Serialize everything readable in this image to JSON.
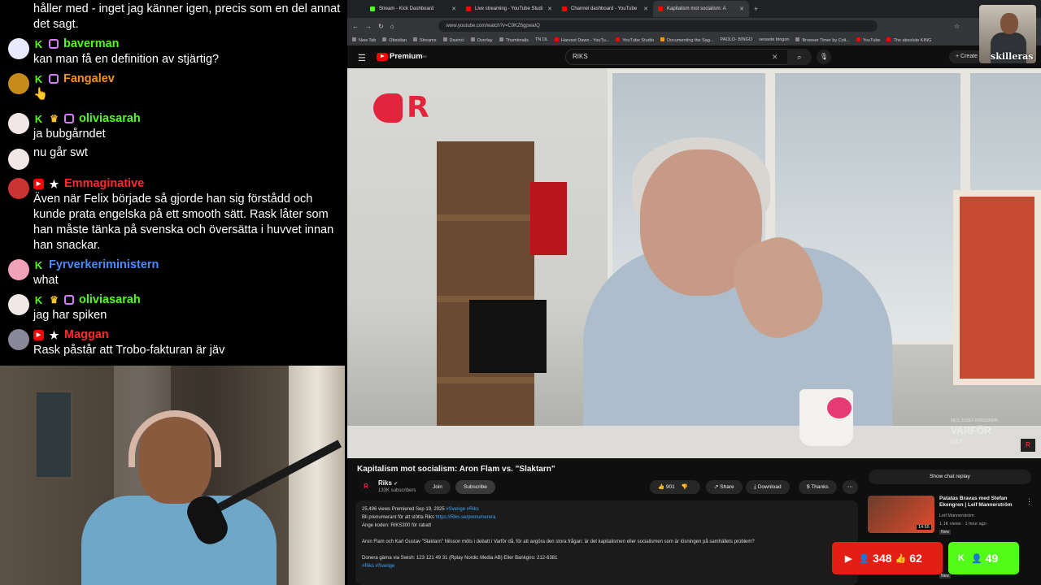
{
  "chat": {
    "messages": [
      {
        "user": "",
        "color": "#ffffff",
        "text": "håller med - inget jag känner igen, precis som en del annat det sagt.",
        "badges": []
      },
      {
        "user": "baverman",
        "color": "#53fc18",
        "text": "kan man få en definition av stjärtig?",
        "badges": [
          "kick",
          "sub"
        ]
      },
      {
        "user": "Fangalev",
        "color": "#f7941d",
        "text": "👆",
        "badges": [
          "kick",
          "sub"
        ]
      },
      {
        "user": "oliviasarah",
        "color": "#53fc18",
        "text": "ja bubgårndet",
        "badges": [
          "kick",
          "crown",
          "sub"
        ]
      },
      {
        "user": "",
        "color": "#ffffff",
        "text": "nu går swt",
        "badges": []
      },
      {
        "user": "Emmaginative",
        "color": "#ff2b2b",
        "text": "Även när Felix började så gjorde han sig förstådd och kunde prata engelska på ett smooth sätt. Rask låter som han måste tänka på svenska och översätta i huvvet innan han snackar.",
        "badges": [
          "youtube",
          "star"
        ]
      },
      {
        "user": "Fyrverkeriministern",
        "color": "#4a8cff",
        "text": "what",
        "badges": [
          "kick"
        ]
      },
      {
        "user": "oliviasarah",
        "color": "#53fc18",
        "text": "jag har spiken",
        "badges": [
          "kick",
          "crown",
          "sub"
        ]
      },
      {
        "user": "Maggan",
        "color": "#ff2b2b",
        "text": "Rask påstår att Trobo-fakturan är jäv",
        "badges": [
          "youtube",
          "star"
        ]
      }
    ]
  },
  "browser": {
    "tabs": [
      {
        "label": "Stream - Kick Dashboard",
        "icon": "kick"
      },
      {
        "label": "Live streaming - YouTube Studi",
        "icon": "youtube"
      },
      {
        "label": "Channel dashboard - YouTube",
        "icon": "youtube"
      },
      {
        "label": "Kapitalism mot socialism: A",
        "icon": "youtube",
        "active": true
      }
    ],
    "url": "www.youtube.com/watch?v=C9KZ6gpwaIQ",
    "bookmarks": [
      "New Tab",
      "Obsidian",
      "Streams",
      "Davinci",
      "Overlay",
      "Thumbnails",
      "TN DL",
      "Harvest Dawn - YouTu...",
      "YouTube Studio",
      "Documenting the Sag...",
      "PAOLO- BINGO",
      "senaste bingon",
      "Browser Timer by Coli...",
      "YouTube",
      "The absolute KING"
    ]
  },
  "youtube": {
    "logo_text": "Premium",
    "logo_sup": "SE",
    "search_value": "RIKS",
    "create_label": "Create",
    "video": {
      "title": "Kapitalism mot socialism: Aron Flam vs. \"Slaktarn\"",
      "channel": "Riks",
      "subscribers": "133K subscribers",
      "join_label": "Join",
      "subscribe_label": "Subscribe",
      "likes": "901",
      "share_label": "Share",
      "download_label": "Download",
      "thanks_label": "Thanks",
      "watermark_line1": "VARFÖR",
      "watermark_line2": "DÅ?",
      "watermark_small": "MED JOSEF KRESSNER",
      "description": {
        "meta": "25,496 views  Premiered Sep 19, 2025",
        "tags": "#Sverige #Riks",
        "line1": "Bli prenumerant för att stötta Riks",
        "line1_link": "https://Riks.se/prenumerera",
        "line2": "Ange koden: RIKS300 för rabatt",
        "line3": "Aron Flam och Karl Gustav \"Slaktarn\" Nilsson möts i debatt i Varför då, för att avgöra den stora frågan: är det kapitalismen eller socialismen som är lösningen på samhällets problem?",
        "line4": "Donera gärna via Swish: 123 121 49 31 (Rplay Nordic Media AB) Eller Bankgiro: 212-6381",
        "footer_tags": "#Riks #Sverige"
      }
    },
    "sidebar": {
      "chat_replay_label": "Show chat replay",
      "rec_title": "Patatas Bravas med Stefan Ekengren  | Leif Mannerström",
      "rec_channel": "Leif Mannerström",
      "rec_meta": "1.1K views · 1 hour ago",
      "rec_duration": "14:55",
      "rec_badge": "New"
    }
  },
  "overlay": {
    "streamer_name": "skilleras",
    "youtube_viewers": "348",
    "youtube_likes": "62",
    "kick_viewers": "49",
    "colors": {
      "youtube": "#e41e14",
      "kick": "#53fc18"
    }
  }
}
